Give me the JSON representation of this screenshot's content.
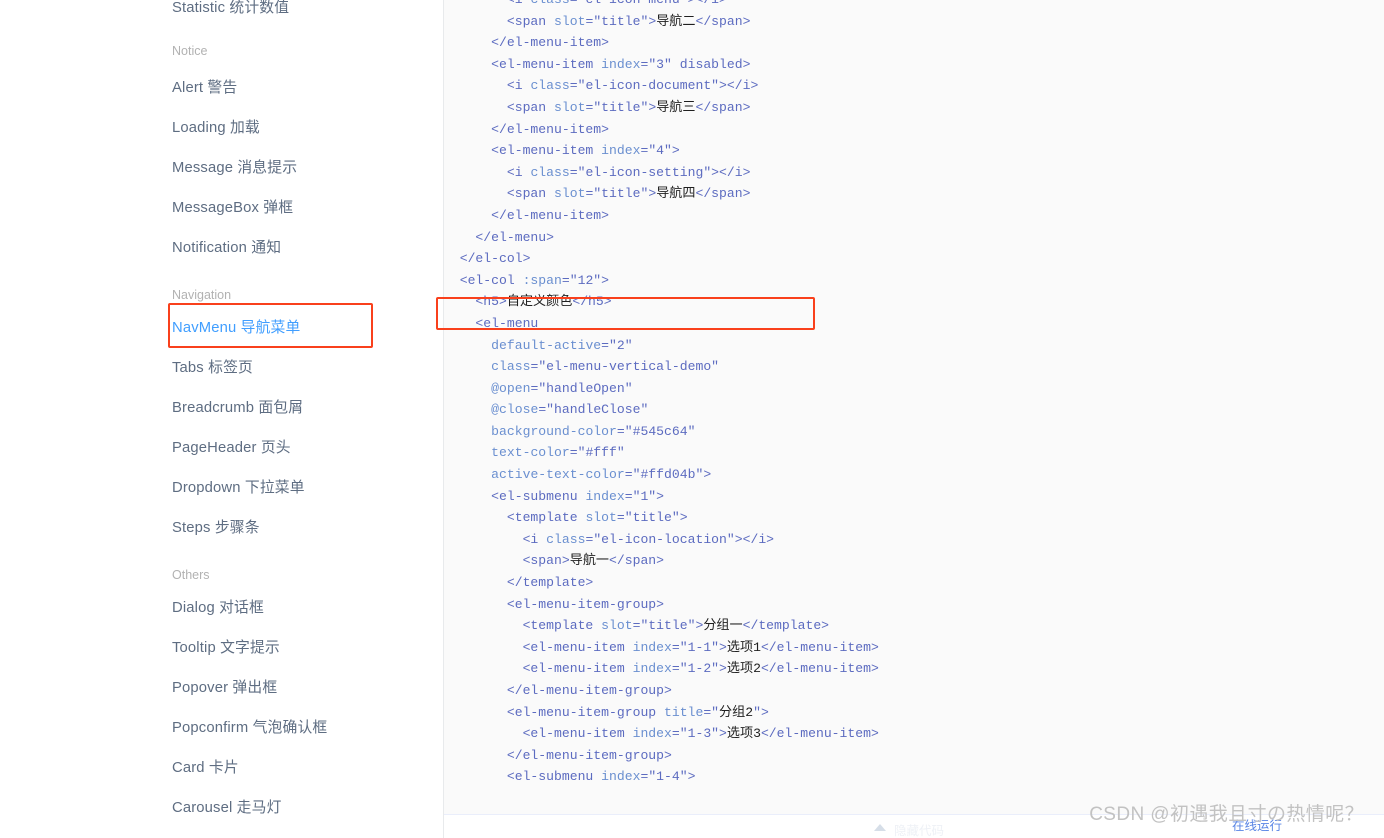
{
  "sidebar": {
    "groups": [
      {
        "title": "",
        "items": [
          {
            "label": "Statistic 统计数值",
            "active": false,
            "clipped": true
          }
        ]
      },
      {
        "title": "Notice",
        "items": [
          {
            "label": "Alert 警告",
            "active": false
          },
          {
            "label": "Loading 加载",
            "active": false
          },
          {
            "label": "Message 消息提示",
            "active": false
          },
          {
            "label": "MessageBox 弹框",
            "active": false
          },
          {
            "label": "Notification 通知",
            "active": false
          }
        ]
      },
      {
        "title": "Navigation",
        "items": [
          {
            "label": "NavMenu 导航菜单",
            "active": true
          },
          {
            "label": "Tabs 标签页",
            "active": false
          },
          {
            "label": "Breadcrumb 面包屑",
            "active": false
          },
          {
            "label": "PageHeader 页头",
            "active": false
          },
          {
            "label": "Dropdown 下拉菜单",
            "active": false
          },
          {
            "label": "Steps 步骤条",
            "active": false
          }
        ]
      },
      {
        "title": "Others",
        "items": [
          {
            "label": "Dialog 对话框",
            "active": false
          },
          {
            "label": "Tooltip 文字提示",
            "active": false
          },
          {
            "label": "Popover 弹出框",
            "active": false
          },
          {
            "label": "Popconfirm 气泡确认框",
            "active": false
          },
          {
            "label": "Card 卡片",
            "active": false
          },
          {
            "label": "Carousel 走马灯",
            "active": false
          }
        ]
      }
    ]
  },
  "annotations": {
    "navmenu_box_color": "#f9401c",
    "h5_box_color": "#f9401c"
  },
  "code": {
    "lines": [
      "        <i class=\"el-icon-menu\"></i>",
      "        <span slot=\"title\">导航二</span>",
      "      </el-menu-item>",
      "      <el-menu-item index=\"3\" disabled>",
      "        <i class=\"el-icon-document\"></i>",
      "        <span slot=\"title\">导航三</span>",
      "      </el-menu-item>",
      "      <el-menu-item index=\"4\">",
      "        <i class=\"el-icon-setting\"></i>",
      "        <span slot=\"title\">导航四</span>",
      "      </el-menu-item>",
      "    </el-menu>",
      "  </el-col>",
      "  <el-col :span=\"12\">",
      "    <h5>自定义颜色</h5>",
      "    <el-menu",
      "      default-active=\"2\"",
      "      class=\"el-menu-vertical-demo\"",
      "      @open=\"handleOpen\"",
      "      @close=\"handleClose\"",
      "      background-color=\"#545c64\"",
      "      text-color=\"#fff\"",
      "      active-text-color=\"#ffd04b\">",
      "      <el-submenu index=\"1\">",
      "        <template slot=\"title\">",
      "          <i class=\"el-icon-location\"></i>",
      "          <span>导航一</span>",
      "        </template>",
      "        <el-menu-item-group>",
      "          <template slot=\"title\">分组一</template>",
      "          <el-menu-item index=\"1-1\">选项1</el-menu-item>",
      "          <el-menu-item index=\"1-2\">选项2</el-menu-item>",
      "        </el-menu-item-group>",
      "        <el-menu-item-group title=\"分组2\">",
      "          <el-menu-item index=\"1-3\">选项3</el-menu-item>",
      "        </el-menu-item-group>",
      "        <el-submenu index=\"1-4\">"
    ]
  },
  "bottom": {
    "collapse_label": "隐藏代码",
    "run_online_label": "在线运行"
  },
  "watermark": {
    "text": "CSDN @初遇我且寸の热情呢？"
  }
}
